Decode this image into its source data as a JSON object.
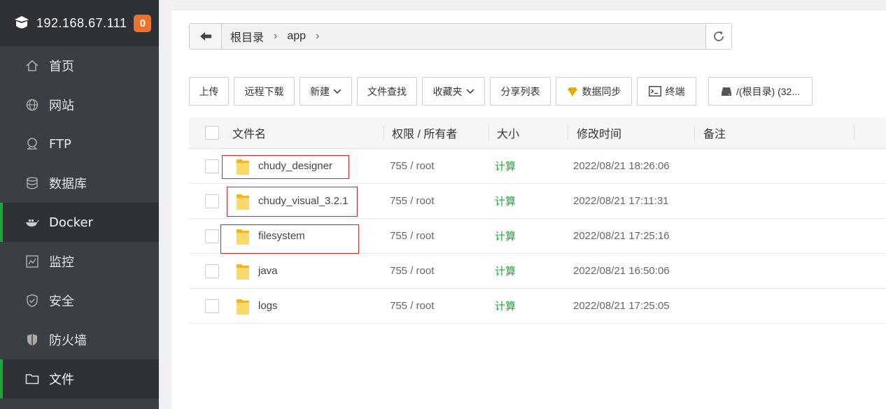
{
  "sidebar": {
    "server_ip": "192.168.67.111",
    "badge_count": "0",
    "items": [
      {
        "label": "首页",
        "icon": "home-icon",
        "active": false
      },
      {
        "label": "网站",
        "icon": "globe-icon",
        "active": false
      },
      {
        "label": "FTP",
        "icon": "ftp-icon",
        "active": false
      },
      {
        "label": "数据库",
        "icon": "database-icon",
        "active": false
      },
      {
        "label": "Docker",
        "icon": "docker-icon",
        "active": true
      },
      {
        "label": "监控",
        "icon": "monitor-icon",
        "active": false
      },
      {
        "label": "安全",
        "icon": "shield-check-icon",
        "active": false
      },
      {
        "label": "防火墙",
        "icon": "firewall-shield-icon",
        "active": false
      },
      {
        "label": "文件",
        "icon": "folder-icon",
        "active": true
      }
    ]
  },
  "pathbar": {
    "crumbs": [
      "根目录",
      "app"
    ]
  },
  "toolbar": {
    "upload": "上传",
    "remote_download": "远程下载",
    "new": "新建",
    "file_search": "文件查找",
    "favorites": "收藏夹",
    "share_list": "分享列表",
    "data_sync": "数据同步",
    "terminal": "终端",
    "disk": "/(根目录) (32..."
  },
  "table": {
    "headers": {
      "name": "文件名",
      "perm": "权限 / 所有者",
      "size": "大小",
      "mtime": "修改时间",
      "note": "备注"
    },
    "rows": [
      {
        "name": "chudy_designer",
        "perm": "755 / root",
        "size": "计算",
        "mtime": "2022/08/21 18:26:06",
        "highlighted": true
      },
      {
        "name": "chudy_visual_3.2.1",
        "perm": "755 / root",
        "size": "计算",
        "mtime": "2022/08/21 17:11:31",
        "highlighted": true
      },
      {
        "name": "filesystem",
        "perm": "755 / root",
        "size": "计算",
        "mtime": "2022/08/21 17:25:16",
        "highlighted": true
      },
      {
        "name": "java",
        "perm": "755 / root",
        "size": "计算",
        "mtime": "2022/08/21 16:50:06",
        "highlighted": false
      },
      {
        "name": "logs",
        "perm": "755 / root",
        "size": "计算",
        "mtime": "2022/08/21 17:25:05",
        "highlighted": false
      }
    ]
  },
  "colors": {
    "sidebar_bg": "#3a3f44",
    "sidebar_active_bg": "#2e3237",
    "accent_green": "#20a53a",
    "badge_orange": "#f0722a",
    "folder_yellow": "#f7c842",
    "highlight_red": "#e02020"
  }
}
